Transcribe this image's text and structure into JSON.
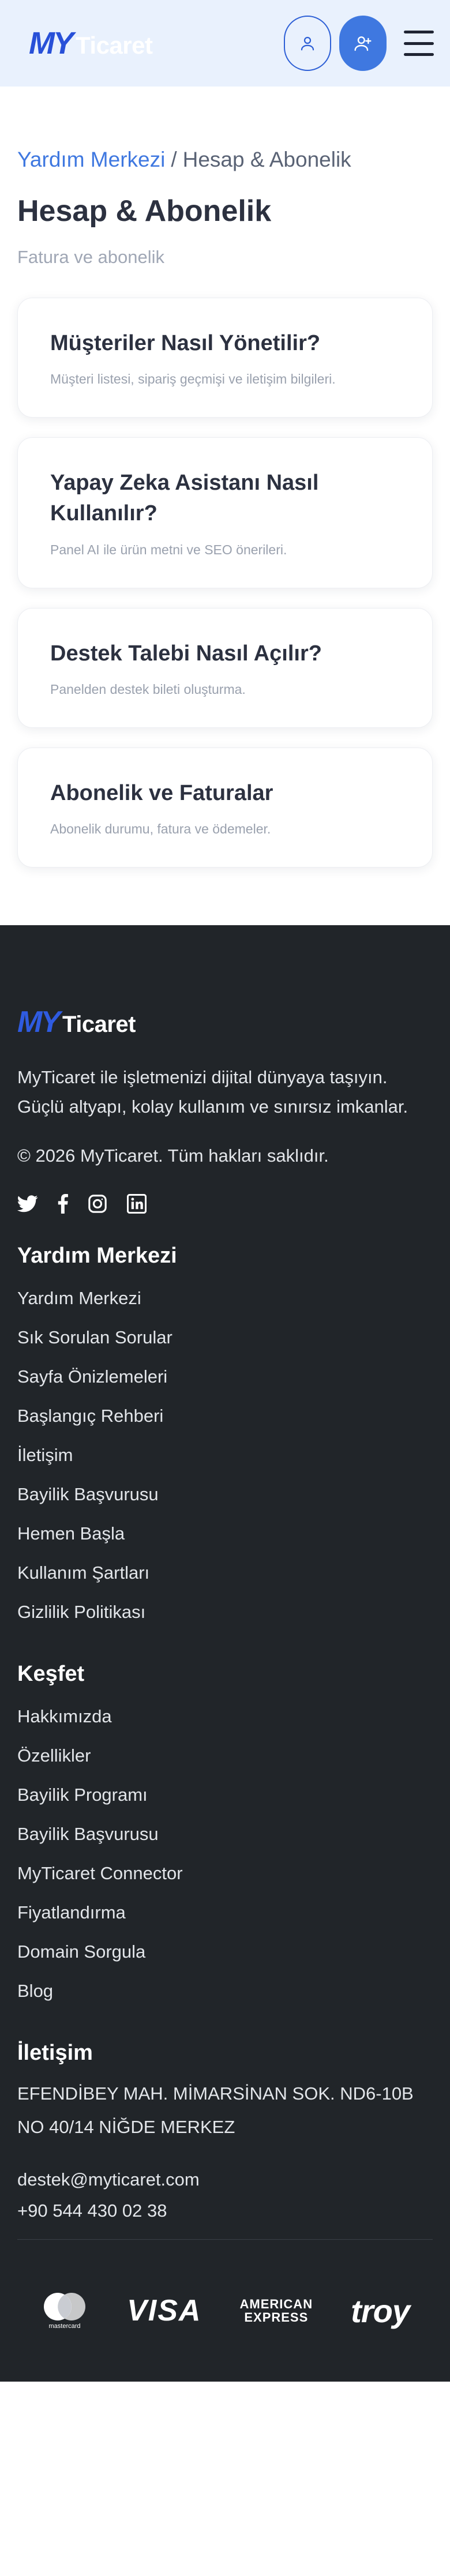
{
  "header": {
    "logo_my": "MY",
    "logo_ticaret": "Ticaret",
    "icons": {
      "login": "user-icon",
      "register": "user-plus-icon",
      "menu": "hamburger-menu-icon"
    },
    "colors": {
      "background": "#e9f1fd",
      "accent": "#3f78e0",
      "brand": "#2850d8"
    }
  },
  "breadcrumb": {
    "link": "Yardım Merkezi",
    "separator": "/",
    "current": "Hesap & Abonelik"
  },
  "page": {
    "title": "Hesap & Abonelik",
    "subtitle": "Fatura ve abonelik"
  },
  "articles": [
    {
      "title": "Müşteriler Nasıl Yönetilir?",
      "desc": "Müşteri listesi, sipariş geçmişi ve iletişim bilgileri."
    },
    {
      "title": "Yapay Zeka Asistanı Nasıl Kullanılır?",
      "desc": "Panel AI ile ürün metni ve SEO önerileri."
    },
    {
      "title": "Destek Talebi Nasıl Açılır?",
      "desc": "Panelden destek bileti oluşturma."
    },
    {
      "title": "Abonelik ve Faturalar",
      "desc": "Abonelik durumu, fatura ve ödemeler."
    }
  ],
  "footer": {
    "logo_my": "MY",
    "logo_ticaret": "Ticaret",
    "about": "MyTicaret ile işletmenizi dijital dünyaya taşıyın. Güçlü altyapı, kolay kullanım ve sınırsız imkanlar.",
    "copyright": "© 2026 MyTicaret. Tüm hakları saklıdır.",
    "socials": [
      "twitter-icon",
      "facebook-icon",
      "instagram-icon",
      "linkedin-icon"
    ],
    "help_heading": "Yardım Merkezi",
    "help_links": [
      "Yardım Merkezi",
      "Sık Sorulan Sorular",
      "Sayfa Önizlemeleri",
      "Başlangıç Rehberi",
      "İletişim",
      "Bayilik Başvurusu",
      "Hemen Başla",
      "Kullanım Şartları",
      "Gizlilik Politikası"
    ],
    "explore_heading": "Keşfet",
    "explore_links": [
      "Hakkımızda",
      "Özellikler",
      "Bayilik Programı",
      "Bayilik Başvurusu",
      "MyTicaret Connector",
      "Fiyatlandırma",
      "Domain Sorgula",
      "Blog"
    ],
    "contact_heading": "İletişim",
    "address": "EFENDİBEY MAH. MİMARSİNAN SOK. ND6-10B NO 40/14 NİĞDE MERKEZ",
    "email": "destek@myticaret.com",
    "phone": "+90 544 430 02 38",
    "payments": {
      "mastercard": "mastercard",
      "visa": "VISA",
      "amex_line1": "AMERICAN",
      "amex_line2": "EXPRESS",
      "troy": "troy"
    },
    "colors": {
      "background": "#212529"
    }
  }
}
